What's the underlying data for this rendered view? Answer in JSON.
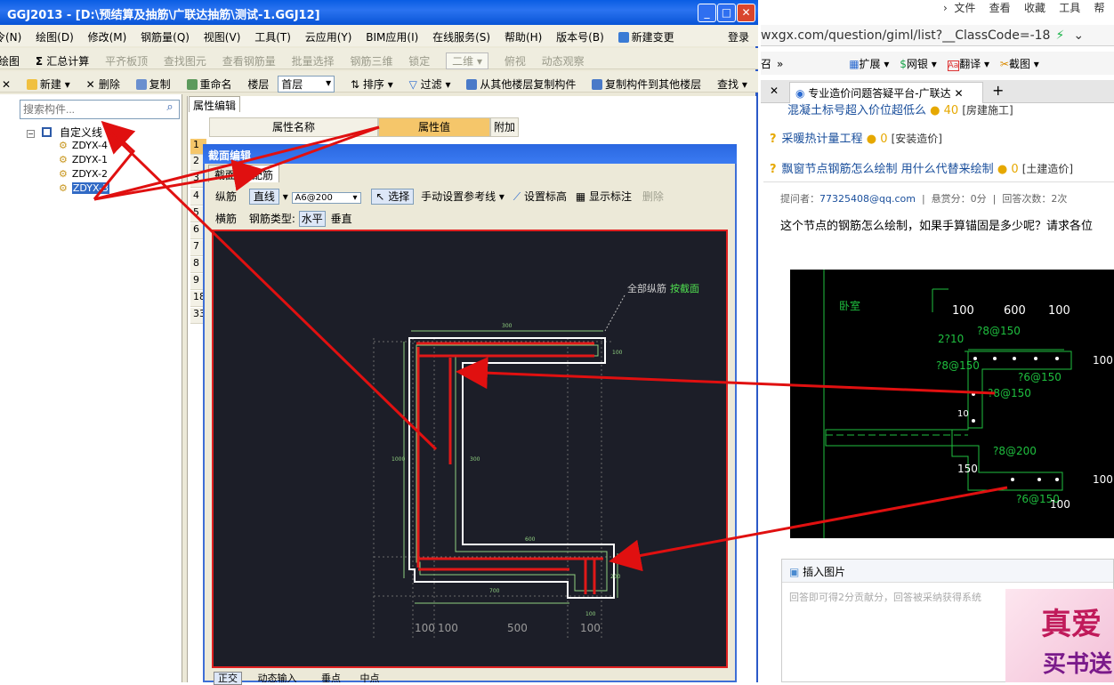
{
  "app": {
    "title": "GGJ2013 - [D:\\预结算及抽筋\\广联达抽筋\\测试-1.GGJ12]",
    "win_buttons": [
      "_",
      "□",
      "✕"
    ],
    "menu": [
      "令(N)",
      "绘图(D)",
      "修改(M)",
      "钢筋量(Q)",
      "视图(V)",
      "工具(T)",
      "云应用(Y)",
      "BIM应用(I)",
      "在线服务(S)",
      "帮助(H)",
      "版本号(B)",
      "新建变更"
    ],
    "login": "登录",
    "toolbar1": [
      "绘图",
      "汇总计算",
      "平齐板顶",
      "查找图元",
      "查看钢筋量",
      "批量选择",
      "钢筋三维",
      "锁定",
      "二维",
      "俯视",
      "动态观察"
    ],
    "toolbar2": {
      "new": "新建",
      "delete": "删除",
      "copy": "复制",
      "rename": "重命名",
      "floor_label": "楼层",
      "floor_value": "首层",
      "sort": "排序",
      "filter": "过滤",
      "copy_from": "从其他楼层复制构件",
      "copy_to": "复制构件到其他楼层",
      "find": "查找"
    },
    "search_placeholder": "搜索构件...",
    "tree": {
      "root": "自定义线",
      "items": [
        "ZDYX-4",
        "ZDYX-1",
        "ZDYX-2",
        "ZDYX-3"
      ]
    },
    "prop_tab": "属性编辑",
    "prop_headers": [
      "属性名称",
      "属性值",
      "附加"
    ],
    "row_numbers": [
      "1",
      "2",
      "3",
      "4",
      "5",
      "6",
      "7",
      "8",
      "9",
      "18",
      "33"
    ]
  },
  "dialog": {
    "title": "截面编辑",
    "tabs": [
      "截面",
      "配筋"
    ],
    "row1": {
      "zj": "纵筋",
      "line": "直线",
      "spec": "A6@200",
      "select": "选择",
      "manual": "手动设置参考线",
      "set_height": "设置标高",
      "show_mark": "显示标注",
      "delete": "删除"
    },
    "row2": {
      "hj": "横筋",
      "type_label": "钢筋类型:",
      "horizontal": "水平",
      "vertical": "垂直"
    },
    "canvas": {
      "label_all": "全部纵筋",
      "label_section": "按截面",
      "bottom_dims": [
        "100",
        "100",
        "500",
        "100"
      ],
      "small_dims": [
        "300",
        "100",
        "1000",
        "300",
        "600",
        "700",
        "200",
        "100"
      ]
    },
    "bottom_bar": [
      "正交",
      "动态输入",
      "垂点",
      "中点"
    ]
  },
  "browser": {
    "url": "wxgx.com/question/giml/list?__ClassCode=-18",
    "toolbar": [
      "召",
      "扩展",
      "网银",
      "翻译",
      "截图"
    ],
    "tab_title": "专业造价问题答疑平台-广联达",
    "questions": [
      {
        "title": "混凝土标号超入价位超低么",
        "score": "40",
        "tag": "[房建施工]"
      },
      {
        "title": "采暖热计量工程",
        "score": "0",
        "tag": "[安装造价]"
      },
      {
        "title": "飘窗节点钢筋怎么绘制 用什么代替来绘制",
        "score": "0",
        "tag": "[土建造价]"
      }
    ],
    "meta": {
      "asker_label": "提问者：",
      "asker": "77325408@qq.com",
      "reward": "悬赏分：0分",
      "answers": "回答次数：2次"
    },
    "body": "这个节点的钢筋怎么绘制，如果手算锚固是多少呢？请求各位",
    "cad": {
      "room": "卧室",
      "dims": [
        "100",
        "600",
        "100"
      ],
      "labels": [
        "2?10",
        "?8@150",
        "?8@150",
        "?6@150",
        "?8@150",
        "?8@200",
        "?6@150"
      ],
      "side": [
        "100",
        "100",
        "10",
        "150",
        "100"
      ]
    },
    "insert_label": "插入图片",
    "insert_placeholder": "回答即可得2分贡献分，回答被采纳获得系统",
    "ad_text1": "真爱",
    "ad_text2": "买书送"
  }
}
